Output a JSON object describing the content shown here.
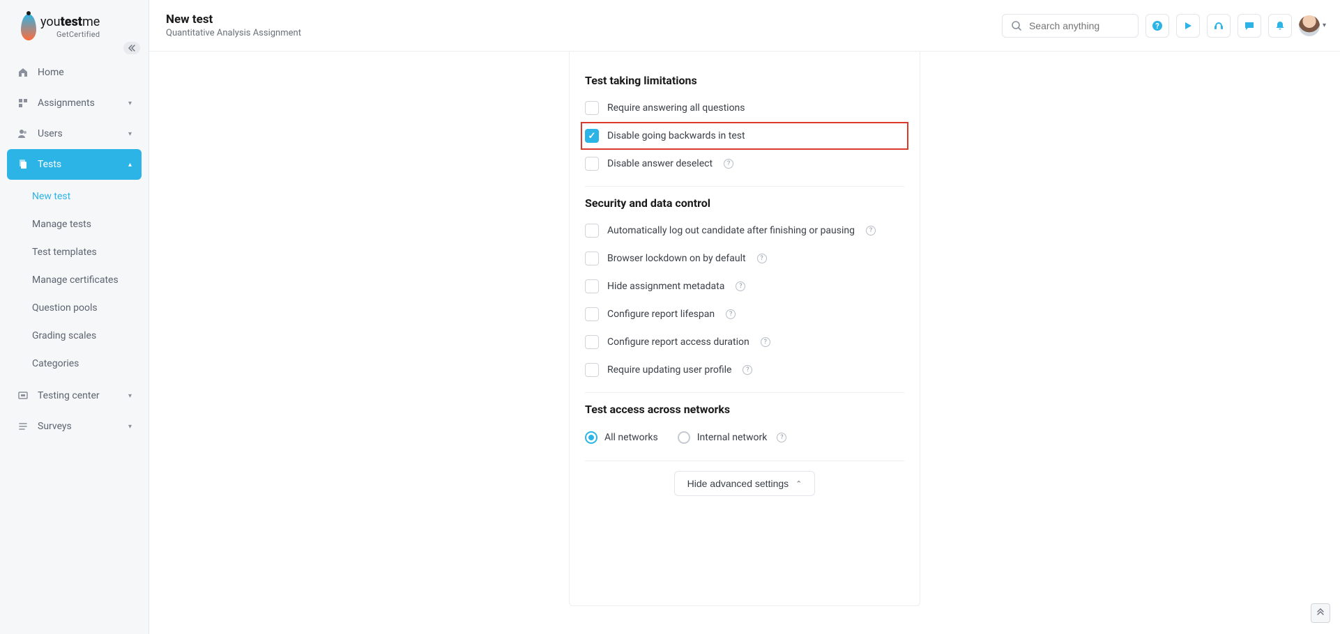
{
  "brand": {
    "name": "youtestme",
    "sub": "GetCertified"
  },
  "header": {
    "title": "New test",
    "subtitle": "Quantitative Analysis Assignment"
  },
  "search": {
    "placeholder": "Search anything"
  },
  "sidebar": {
    "items": [
      {
        "label": "Home",
        "expandable": false
      },
      {
        "label": "Assignments",
        "expandable": true
      },
      {
        "label": "Users",
        "expandable": true
      },
      {
        "label": "Tests",
        "expandable": true,
        "active": true
      },
      {
        "label": "Testing center",
        "expandable": true
      },
      {
        "label": "Surveys",
        "expandable": true
      }
    ],
    "tests_sub": [
      {
        "label": "New test",
        "selected": true
      },
      {
        "label": "Manage tests"
      },
      {
        "label": "Test templates"
      },
      {
        "label": "Manage certificates"
      },
      {
        "label": "Question pools"
      },
      {
        "label": "Grading scales"
      },
      {
        "label": "Categories"
      }
    ]
  },
  "sections": {
    "limitations": {
      "title": "Test taking limitations",
      "opts": [
        {
          "label": "Require answering all questions",
          "checked": false,
          "info": false,
          "highlight": false
        },
        {
          "label": "Disable going backwards in test",
          "checked": true,
          "info": false,
          "highlight": true
        },
        {
          "label": "Disable answer deselect",
          "checked": false,
          "info": true,
          "highlight": false
        }
      ]
    },
    "security": {
      "title": "Security and data control",
      "opts": [
        {
          "label": "Automatically log out candidate after finishing or pausing",
          "checked": false,
          "info": true
        },
        {
          "label": "Browser lockdown on by default",
          "checked": false,
          "info": true
        },
        {
          "label": "Hide assignment metadata",
          "checked": false,
          "info": true
        },
        {
          "label": "Configure report lifespan",
          "checked": false,
          "info": true
        },
        {
          "label": "Configure report access duration",
          "checked": false,
          "info": true
        },
        {
          "label": "Require updating user profile",
          "checked": false,
          "info": true
        }
      ]
    },
    "network": {
      "title": "Test access across networks",
      "opts": [
        {
          "label": "All networks",
          "selected": true,
          "info": false
        },
        {
          "label": "Internal network",
          "selected": false,
          "info": true
        }
      ]
    }
  },
  "buttons": {
    "hide_advanced": "Hide advanced settings"
  },
  "icons": {
    "help": "?",
    "play": "▶",
    "headset": "🎧",
    "chat": "💬",
    "bell": "🔔",
    "home": "⌂",
    "assignments": "▦",
    "users": "👥",
    "tests": "⧉",
    "testing_center": "▣",
    "surveys": "☰"
  },
  "colors": {
    "accent": "#2cb4e6",
    "danger": "#d93a2b"
  }
}
